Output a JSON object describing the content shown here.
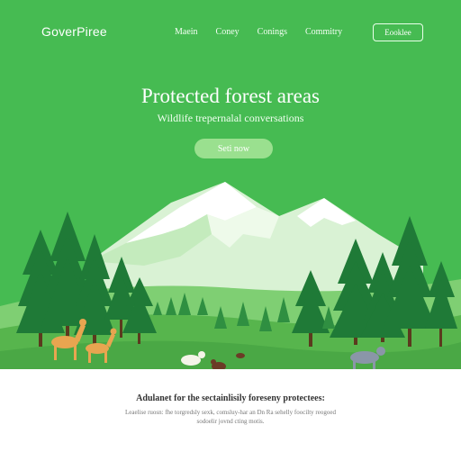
{
  "nav": {
    "logo": "GoverPiree",
    "links": [
      "Maein",
      "Coney",
      "Conings",
      "Commitry"
    ],
    "button_label": "Eooklee"
  },
  "hero": {
    "headline": "Protected forest areas",
    "subline": "Wildlife trepernalal conversations",
    "cta_label": "Seti now"
  },
  "footer": {
    "title": "Adulanet for the sectainlisily foreseny protectees:",
    "description": "Leaelise ruosn: fhe torgredsly sexk, comsluy-har an Dn Ra sehelly foocilty reogoed sodoelir jovnd cting motis."
  },
  "colors": {
    "hero_green": "#46bb52",
    "button_green": "#9ae08f",
    "tree_dark": "#1f7a37",
    "snow": "#ffffff"
  }
}
